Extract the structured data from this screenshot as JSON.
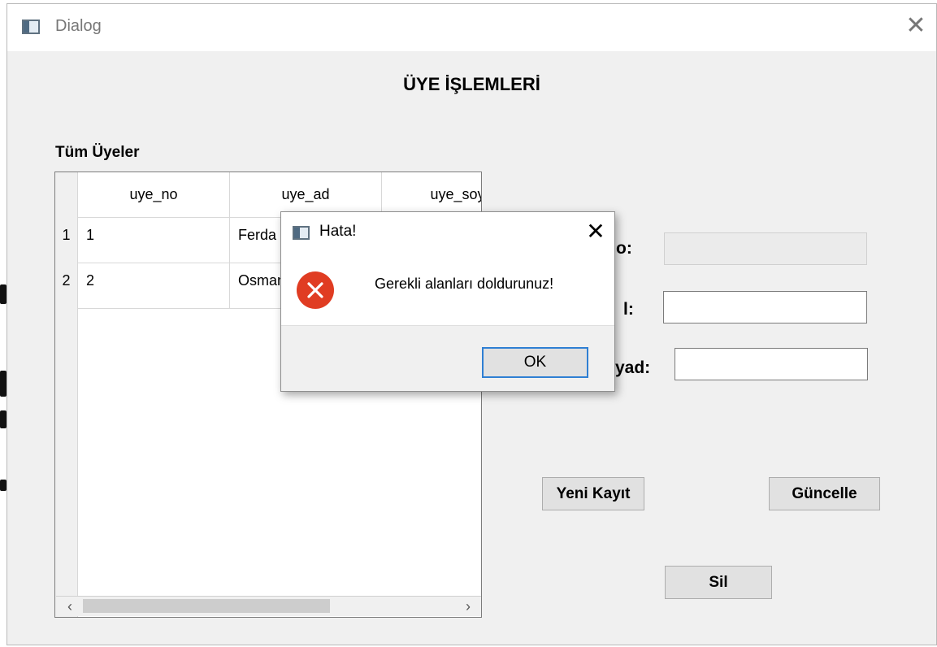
{
  "window": {
    "title": "Dialog",
    "close_glyph": "✕"
  },
  "main": {
    "heading": "ÜYE İŞLEMLERİ",
    "list_heading": "Tüm Üyeler"
  },
  "table": {
    "columns": [
      "uye_no",
      "uye_ad",
      "uye_soy"
    ],
    "rows": [
      {
        "number": "1",
        "cells": [
          "1",
          "Ferda",
          ""
        ]
      },
      {
        "number": "2",
        "cells": [
          "2",
          "Osman",
          ""
        ]
      }
    ],
    "scroll_left": "‹",
    "scroll_right": "›"
  },
  "form": {
    "labels": [
      "o:",
      "l:",
      "yad:"
    ],
    "fields": [
      {
        "value": "",
        "enabled": false
      },
      {
        "value": "",
        "enabled": true
      },
      {
        "value": "",
        "enabled": true
      }
    ]
  },
  "buttons": {
    "new_record": "Yeni Kayıt",
    "update": "Güncelle",
    "delete": "Sil"
  },
  "modal": {
    "title": "Hata!",
    "close_glyph": "✕",
    "message": "Gerekli alanları doldurunuz!",
    "ok": "OK"
  },
  "colors": {
    "error": "#e03c22",
    "focus": "#2f7fd3",
    "window_bg": "#f0f0f0"
  },
  "icons": [
    "app-icon",
    "close-icon",
    "error-icon"
  ]
}
